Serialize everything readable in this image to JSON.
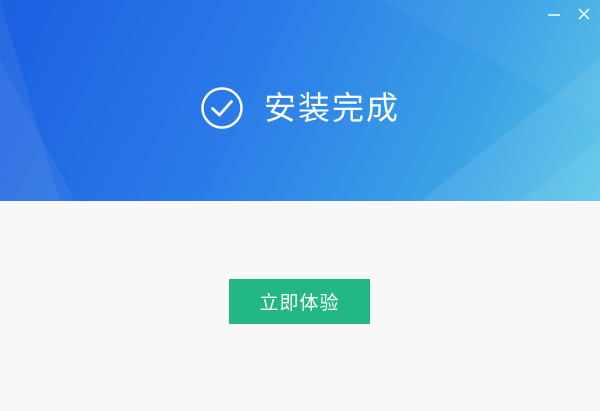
{
  "window": {
    "controls": {
      "minimize_icon": "minimize-icon",
      "close_icon": "close-icon"
    }
  },
  "header": {
    "status_icon": "check-circle-icon",
    "status_text": "安装完成"
  },
  "main": {
    "primary_button_label": "立即体验"
  },
  "colors": {
    "header_gradient_start": "#1b5fe0",
    "header_gradient_end": "#55c4e8",
    "button_bg": "#23b783",
    "body_bg": "#f8f8f8"
  }
}
